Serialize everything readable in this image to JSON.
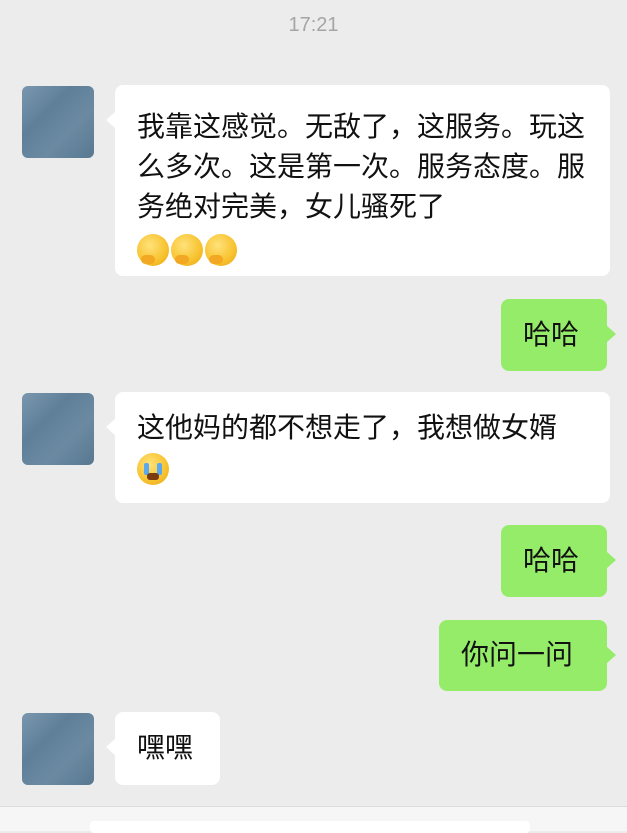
{
  "header": {
    "time": "17:21"
  },
  "messages": [
    {
      "side": "in",
      "text": "我靠这感觉。无敌了，这服务。玩这么多次。这是第一次。服务态度。服务绝对完美，女儿骚死了",
      "emojis": [
        "covering-mouth-emoji",
        "covering-mouth-emoji",
        "covering-mouth-emoji"
      ]
    },
    {
      "side": "out",
      "text": "哈哈"
    },
    {
      "side": "in",
      "text": "这他妈的都不想走了，我想做女婿",
      "emojis": [
        "crying-emoji"
      ]
    },
    {
      "side": "out",
      "text": "哈哈"
    },
    {
      "side": "out",
      "text": "你问一问"
    },
    {
      "side": "in",
      "text": "嘿嘿"
    }
  ]
}
